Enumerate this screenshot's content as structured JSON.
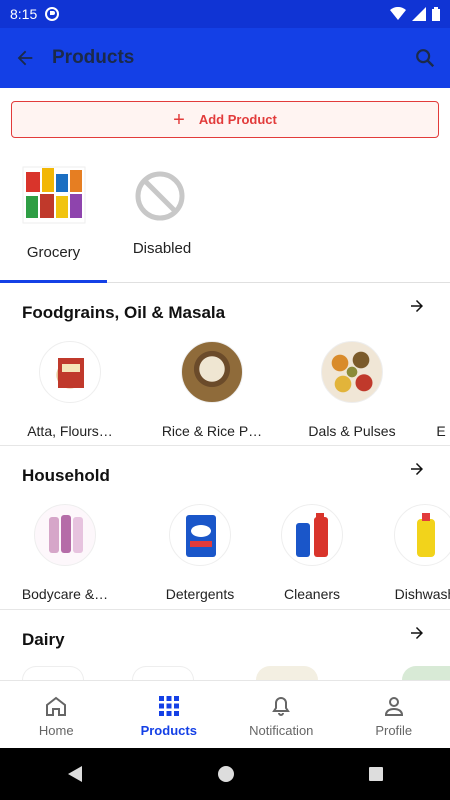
{
  "status": {
    "time": "8:15"
  },
  "appbar": {
    "title": "Products"
  },
  "add_button": {
    "label": "Add Product"
  },
  "tabs": [
    {
      "label": "Grocery",
      "icon": "grocery-image"
    },
    {
      "label": "Disabled",
      "icon": "disabled-icon"
    }
  ],
  "sections": [
    {
      "title": "Foodgrains, Oil & Masala",
      "items": [
        "Atta, Flours…",
        "Rice & Rice P…",
        "Dals & Pulses",
        "E"
      ]
    },
    {
      "title": "Household",
      "items": [
        "Bodycare &…",
        "Detergents",
        "Cleaners",
        "Dishwash"
      ]
    },
    {
      "title": "Dairy",
      "items": []
    }
  ],
  "bottom_nav": [
    {
      "label": "Home",
      "icon": "home-icon"
    },
    {
      "label": "Products",
      "icon": "grid-icon"
    },
    {
      "label": "Notification",
      "icon": "bell-icon"
    },
    {
      "label": "Profile",
      "icon": "profile-icon"
    }
  ],
  "colors": {
    "primary": "#1440e6",
    "accent_red": "#e23b3b"
  }
}
